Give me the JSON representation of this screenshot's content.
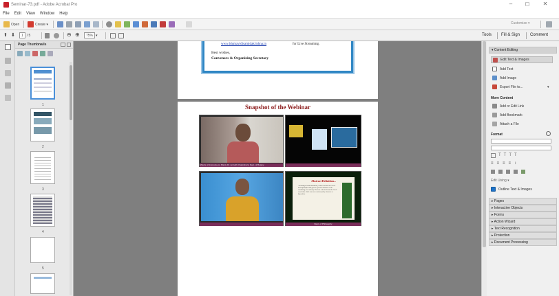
{
  "window": {
    "title": "Seminar-73.pdf - Adobe Acrobat Pro",
    "controls": {
      "minimize": "–",
      "maximize": "◻",
      "close": "✕"
    }
  },
  "menu": [
    "File",
    "Edit",
    "View",
    "Window",
    "Help"
  ],
  "toolbar": {
    "open": "Open",
    "create": "Create ▾",
    "customize": "Customize ▾"
  },
  "nav": {
    "page": "1",
    "page_total": "/ 5",
    "zoom": "75%"
  },
  "tabs": {
    "tools": "Tools",
    "fill_sign": "Fill & Sign",
    "comment": "Comment"
  },
  "left_panel": {
    "title": "Page Thumbnails",
    "page_labels": [
      "1",
      "2",
      "3",
      "4",
      "5"
    ]
  },
  "document": {
    "letter": {
      "email": "www.ldumavidisamidakrishna.in",
      "email_tail": "for Live Streaming.",
      "closing": "Best wishes,",
      "signature": "Convenors  & Organizing Secretary"
    },
    "heading": "Snapshot of the Webinar",
    "shot_caption": "Effects of Ammonia on Plants   Dr. Anirudh Chakraborty Dept. of Botany",
    "slide2": {
      "title": "Abstract Definition...",
      "body": "According to most dictionaries, ethics is defined as a set of moral principles that govern a person's behavior or the conducting of an activity. The term is derived from the Greek word ethos which can mean custom, habit, character or disposition.",
      "footer": "Dept. of Philosophy"
    }
  },
  "right_panel": {
    "content_editing": "▾ Content Editing",
    "items": [
      "Edit Text & Images",
      "Add Text",
      "Add Image",
      "Export File to..."
    ],
    "more_content": "More Content",
    "more_items": [
      "Add or Edit Link",
      "Add Bookmark",
      "Attach a File"
    ],
    "format": "Format",
    "font_size": "Edit Using ▾",
    "outline": "Outline Text & Images",
    "sections": [
      "▸ Pages",
      "▸ Interactive Objects",
      "▸ Forms",
      "▸ Action Wizard",
      "▸ Text Recognition",
      "▸ Protection",
      "▸ Document Processing"
    ]
  },
  "colors": {
    "accent": "#1e73c9",
    "heading": "#8b1a1a",
    "frame": "#2f86c4"
  }
}
